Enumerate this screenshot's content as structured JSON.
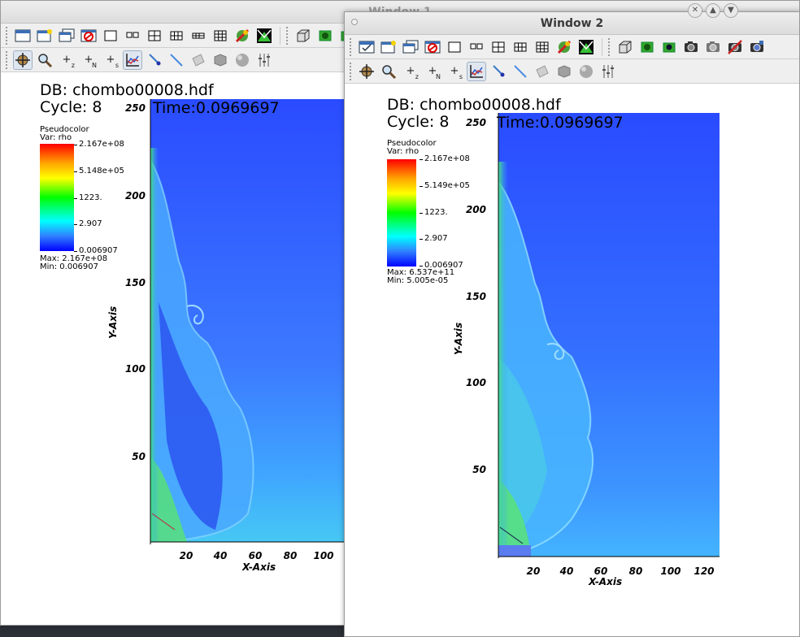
{
  "window1": {
    "title": "Window 1",
    "plot": {
      "db": "DB: chombo00008.hdf",
      "cycle": "Cycle: 8",
      "time": "Time:0.0969697",
      "legend": {
        "type": "Pseudocolor",
        "var": "Var: rho",
        "ticks": [
          "2.167e+08",
          "5.148e+05",
          "1223.",
          "2.907",
          "0.006907"
        ],
        "max": "Max:  2.167e+08",
        "min": "Min:  0.006907"
      },
      "y_ticks": [
        "250",
        "200",
        "150",
        "100",
        "50"
      ],
      "x_ticks": [
        "20",
        "40",
        "60",
        "80",
        "100"
      ],
      "x_label": "X-Axis",
      "y_label": "Y-Axis"
    }
  },
  "window2": {
    "title": "Window 2",
    "plot": {
      "db": "DB: chombo00008.hdf",
      "cycle": "Cycle: 8",
      "time": "Time:0.0969697",
      "legend": {
        "type": "Pseudocolor",
        "var": "Var: rho",
        "ticks": [
          "2.167e+08",
          "5.149e+05",
          "1223.",
          "2.907",
          "0.006907"
        ],
        "max": "Max:  6.537e+11",
        "min": "Min:  5.005e-05"
      },
      "y_ticks": [
        "250",
        "200",
        "150",
        "100",
        "50"
      ],
      "x_ticks": [
        "20",
        "40",
        "60",
        "80",
        "100",
        "120"
      ],
      "x_label": "X-Axis",
      "y_label": "Y-Axis"
    }
  },
  "toolbar_icons": {
    "row1": [
      "clear-window-icon",
      "new-window-icon",
      "copy-window-icon",
      "delete-window-icon",
      "layout-1x1-icon",
      "layout-1x2-icon",
      "layout-2x2-icon",
      "layout-2x3-icon",
      "layout-3x2-icon",
      "layout-3x3-icon",
      "lock-view-icon",
      "lock-time-icon",
      "perspective-icon",
      "spin-icon",
      "camera-icon",
      "save-image-icon",
      "print-icon",
      "undo-view-icon"
    ],
    "row2": [
      "navigate-icon",
      "zoom-icon",
      "zone-pick-icon",
      "node-pick-icon",
      "spreadsheet-pick-icon",
      "lineout-icon",
      "point-tool-icon",
      "line-tool-icon",
      "plane-tool-icon",
      "box-tool-icon",
      "sphere-tool-icon",
      "axis-restriction-icon"
    ],
    "row2_labels": {
      "zone_pick": "+z",
      "node_pick": "+N",
      "spreadsheet_pick": "+s"
    }
  },
  "colors": {
    "accent_blue": "#2a5cff",
    "titlebar": "#e2e2e2"
  }
}
